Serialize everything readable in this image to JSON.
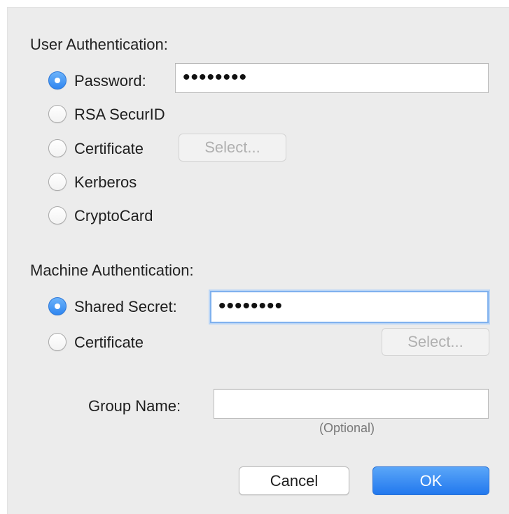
{
  "user_auth": {
    "title": "User Authentication:",
    "options": [
      {
        "label": "Password:",
        "checked": true
      },
      {
        "label": "RSA SecurID",
        "checked": false
      },
      {
        "label": "Certificate",
        "checked": false
      },
      {
        "label": "Kerberos",
        "checked": false
      },
      {
        "label": "CryptoCard",
        "checked": false
      }
    ],
    "password_value": "••••••••",
    "select_label": "Select..."
  },
  "machine_auth": {
    "title": "Machine Authentication:",
    "options": [
      {
        "label": "Shared Secret:",
        "checked": true
      },
      {
        "label": "Certificate",
        "checked": false
      }
    ],
    "secret_value": "••••••••",
    "select_label": "Select..."
  },
  "group": {
    "label": "Group Name:",
    "value": "",
    "hint": "(Optional)"
  },
  "buttons": {
    "cancel": "Cancel",
    "ok": "OK"
  },
  "colors": {
    "accent": "#2f86f0",
    "background": "#ececec"
  }
}
